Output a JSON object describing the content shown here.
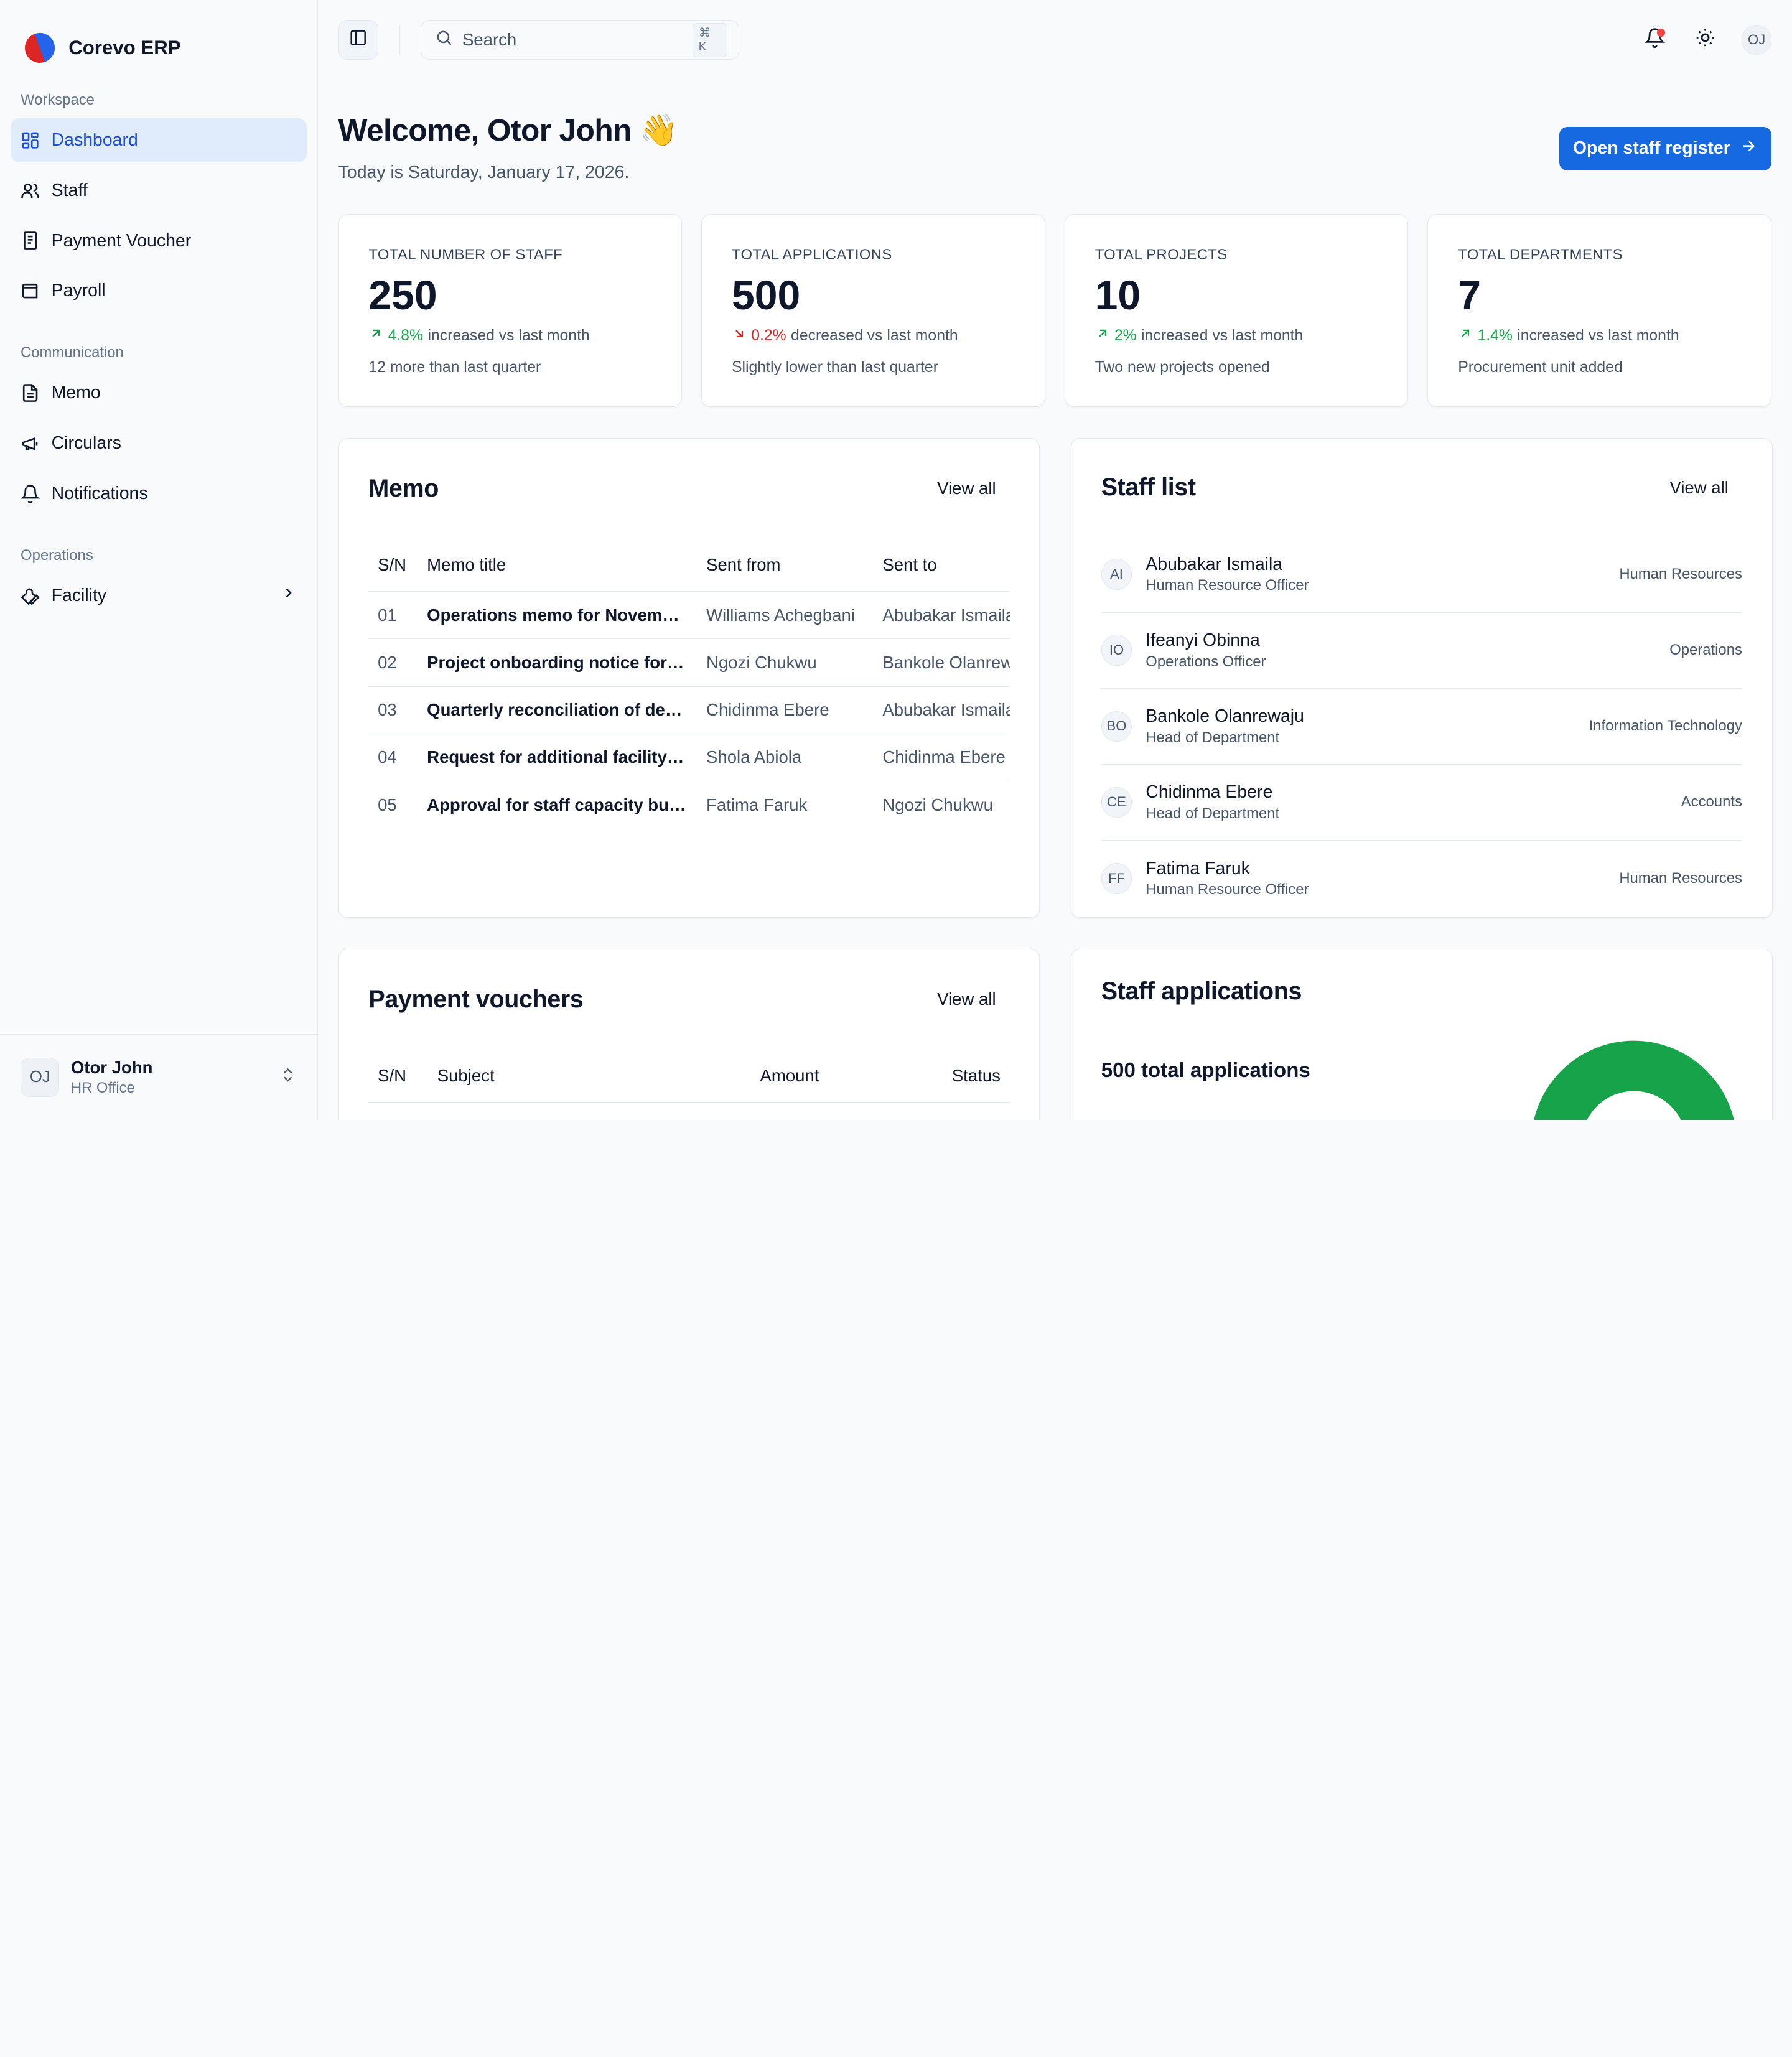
{
  "brand": {
    "name": "Corevo ERP"
  },
  "sidebar": {
    "sections": [
      {
        "label": "Workspace",
        "items": [
          {
            "label": "Dashboard",
            "icon": "dashboard-icon",
            "active": true
          },
          {
            "label": "Staff",
            "icon": "users-icon"
          },
          {
            "label": "Payment Voucher",
            "icon": "receipt-icon"
          },
          {
            "label": "Payroll",
            "icon": "wallet-icon"
          }
        ]
      },
      {
        "label": "Communication",
        "items": [
          {
            "label": "Memo",
            "icon": "file-text-icon"
          },
          {
            "label": "Circulars",
            "icon": "megaphone-icon"
          },
          {
            "label": "Notifications",
            "icon": "bell-icon"
          }
        ]
      },
      {
        "label": "Operations",
        "items": [
          {
            "label": "Facility",
            "icon": "wrench-icon"
          }
        ]
      }
    ],
    "user": {
      "initials": "OJ",
      "name": "Otor John",
      "role": "HR Office"
    }
  },
  "topbar": {
    "search_placeholder": "Search",
    "shortcut": "⌘ K",
    "avatar_initials": "OJ"
  },
  "welcome": {
    "title": "Welcome, Otor John 👋",
    "subtitle": "Today is Saturday, January 17, 2026.",
    "cta": "Open staff register"
  },
  "stats": [
    {
      "label": "TOTAL NUMBER OF STAFF",
      "value": "250",
      "change": "4.8%",
      "direction": "up",
      "trend_text": "increased vs last month",
      "note": "12 more than last quarter"
    },
    {
      "label": "TOTAL APPLICATIONS",
      "value": "500",
      "change": "0.2%",
      "direction": "down",
      "trend_text": "decreased vs last month",
      "note": "Slightly lower than last quarter"
    },
    {
      "label": "TOTAL PROJECTS",
      "value": "10",
      "change": "2%",
      "direction": "up",
      "trend_text": "increased vs last month",
      "note": "Two new projects opened"
    },
    {
      "label": "TOTAL DEPARTMENTS",
      "value": "7",
      "change": "1.4%",
      "direction": "up",
      "trend_text": "increased vs last month",
      "note": "Procurement unit added"
    }
  ],
  "memo": {
    "title": "Memo",
    "view_all": "View all",
    "columns": [
      "S/N",
      "Memo title",
      "Sent from",
      "Sent to"
    ],
    "rows": [
      [
        "01",
        "Operations memo for November",
        "Williams Achegbani",
        "Abubakar Ismaila"
      ],
      [
        "02",
        "Project onboarding notice for new staff",
        "Ngozi Chukwu",
        "Bankole Olanrewaju"
      ],
      [
        "03",
        "Quarterly reconciliation of departmental budgets",
        "Chidinma Ebere",
        "Abubakar Ismaila"
      ],
      [
        "04",
        "Request for additional facility maintenance",
        "Shola Abiola",
        "Chidinma Ebere"
      ],
      [
        "05",
        "Approval for staff capacity building",
        "Fatima Faruk",
        "Ngozi Chukwu"
      ]
    ]
  },
  "staff_list": {
    "title": "Staff list",
    "view_all": "View all",
    "items": [
      {
        "initials": "AI",
        "name": "Abubakar Ismaila",
        "role": "Human Resource Officer",
        "dept": "Human Resources"
      },
      {
        "initials": "IO",
        "name": "Ifeanyi Obinna",
        "role": "Operations Officer",
        "dept": "Operations"
      },
      {
        "initials": "BO",
        "name": "Bankole Olanrewaju",
        "role": "Head of Department",
        "dept": "Information Technology"
      },
      {
        "initials": "CE",
        "name": "Chidinma Ebere",
        "role": "Head of Department",
        "dept": "Accounts"
      },
      {
        "initials": "FF",
        "name": "Fatima Faruk",
        "role": "Human Resource Officer",
        "dept": "Human Resources"
      }
    ]
  },
  "vouchers": {
    "title": "Payment vouchers",
    "view_all": "View all",
    "columns": [
      "S/N",
      "Subject",
      "Amount",
      "Status"
    ]
  },
  "applications": {
    "title": "Staff applications",
    "total_text": "500 total applications",
    "accent": "#16a34a"
  },
  "colors": {
    "accent": "#1669e0",
    "up": "#16a34a",
    "down": "#dc2626",
    "active_bg": "#e0ecfb"
  }
}
